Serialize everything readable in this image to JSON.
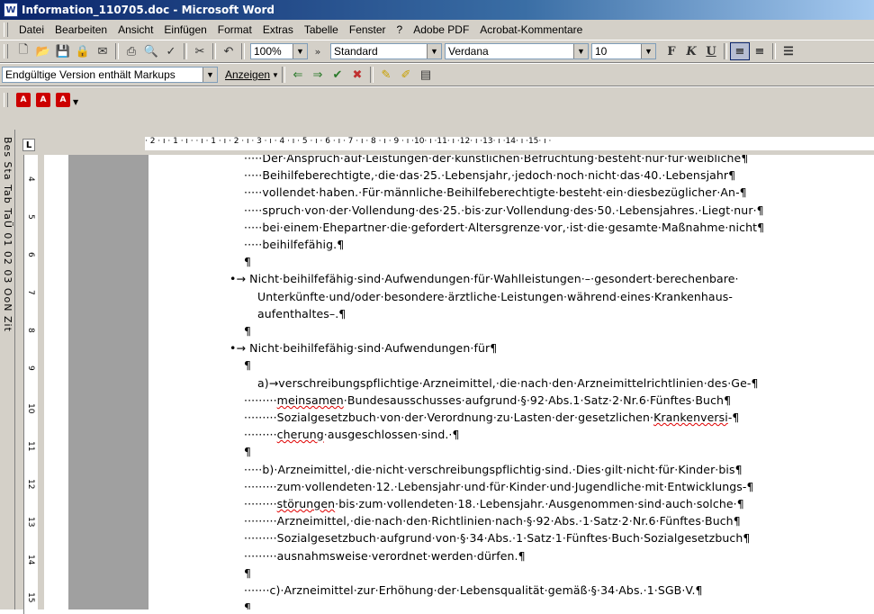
{
  "window": {
    "title": "Information_110705.doc - Microsoft Word",
    "app_icon": "word-doc-icon"
  },
  "menu": [
    "Datei",
    "Bearbeiten",
    "Ansicht",
    "Einfügen",
    "Format",
    "Extras",
    "Tabelle",
    "Fenster",
    "?",
    "Adobe PDF",
    "Acrobat-Kommentare"
  ],
  "toolbar": {
    "zoom": "100%",
    "style": "Standard",
    "font": "Verdana",
    "size": "10",
    "format_buttons": [
      "F",
      "K",
      "U"
    ]
  },
  "reviewing": {
    "markup_view": "Endgültige Version enthält Markups",
    "show_label": "Anzeigen"
  },
  "left_panel_text": "Bes Sta Tab TaÜ 01 02 03 OoN Zit",
  "ruler": {
    "horizontal_ticks": "· 2 · ı · 1 · ı ·  · ı · 1 · ı · 2 · ı · 3 · ı · 4 · ı · 5 · ı · 6 · ı · 7 · ı · 8 · ı · 9 · ı ·10· ı ·11· ı ·12· ı ·13· ı ·14· ı ·15· ı ·",
    "vertical_numbers": [
      "4",
      "5",
      "6",
      "7",
      "8",
      "9",
      "10",
      "11",
      "12",
      "13",
      "14",
      "15"
    ]
  },
  "document": {
    "lines": [
      "·····Der·Anspruch·auf·Leistungen·der·künstlichen·Befruchtung·besteht·nur·für·weibliche¶",
      "·····Beihilfeberechtigte,·die·das·25.·Lebensjahr,·jedoch·noch·nicht·das·40.·Lebensjahr¶",
      "·····vollendet·haben.·Für·männliche·Beihilfeberechtigte·besteht·ein·diesbezüglicher·An-¶",
      "·····spruch·von·der·Vollendung·des·25.·bis·zur·Vollendung·des·50.·Lebensjahres.·Liegt·nur·¶",
      "·····bei·einem·Ehepartner·die·gefordert·Altersgrenze·vor,·ist·die·gesamte·Maßnahme·nicht¶",
      "·····beihilfefähig.¶",
      "¶",
      "•→ Nicht·beihilfefähig·sind·Aufwendungen·für·Wahlleistungen·–·gesondert·berechenbare·",
      "Unterkünfte·und/oder·besondere·ärztliche·Leistungen·während·eines·Krankenhaus-",
      "aufenthaltes–.¶",
      "¶",
      "•→ Nicht·beihilfefähig·sind·Aufwendungen·für¶",
      "¶",
      "a)→verschreibungspflichtige·Arzneimittel,·die·nach·den·Arzneimittelrichtlinien·des·Ge-¶",
      "·········meinsamen·Bundesausschusses·aufgrund·§·92·Abs.1·Satz·2·Nr.6·Fünftes·Buch¶",
      "·········Sozialgesetzbuch·von·der·Verordnung·zu·Lasten·der·gesetzlichen·Krankenversi-¶",
      "·········cherung·ausgeschlossen·sind.·¶",
      "¶",
      "·····b)·Arzneimittel,·die·nicht·verschreibungspflichtig·sind.·Dies·gilt·nicht·für·Kinder·bis¶",
      "·········zum·vollendeten·12.·Lebensjahr·und·für·Kinder·und·Jugendliche·mit·Entwicklungs-¶",
      "·········störungen·bis·zum·vollendeten·18.·Lebensjahr.·Ausgenommen·sind·auch·solche·¶",
      "·········Arzneimittel,·die·nach·den·Richtlinien·nach·§·92·Abs.·1·Satz·2·Nr.6·Fünftes·Buch¶",
      "·········Sozialgesetzbuch·aufgrund·von·§·34·Abs.·1·Satz·1·Fünftes·Buch·Sozialgesetzbuch¶",
      "·········ausnahmsweise·verordnet·werden·dürfen.¶",
      "¶",
      "·······c)·Arzneimittel·zur·Erhöhung·der·Lebensqualität·gemäß·§·34·Abs.·1·SGB·V.¶",
      "¶"
    ]
  }
}
